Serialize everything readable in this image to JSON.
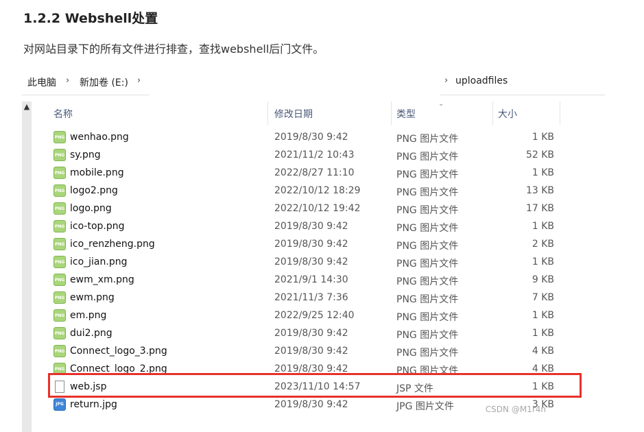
{
  "article": {
    "heading": "1.2.2 Webshell处置",
    "paragraph": "对网站目录下的所有文件进行排查，查找webshell后门文件。"
  },
  "breadcrumb": {
    "items": [
      "此电脑",
      "新加卷 (E:)",
      "uploadfiles"
    ],
    "separator": "›"
  },
  "columns": {
    "name": "名称",
    "date": "修改日期",
    "type": "类型",
    "size": "大小"
  },
  "files": [
    {
      "name": "wenhao.png",
      "date": "2019/8/30 9:42",
      "type": "PNG 图片文件",
      "size": "1 KB",
      "icon": "png-file-icon"
    },
    {
      "name": "sy.png",
      "date": "2021/11/2 10:43",
      "type": "PNG 图片文件",
      "size": "52 KB",
      "icon": "png-file-icon"
    },
    {
      "name": "mobile.png",
      "date": "2022/8/27 11:10",
      "type": "PNG 图片文件",
      "size": "1 KB",
      "icon": "png-file-icon"
    },
    {
      "name": "logo2.png",
      "date": "2022/10/12 18:29",
      "type": "PNG 图片文件",
      "size": "13 KB",
      "icon": "png-file-icon"
    },
    {
      "name": "logo.png",
      "date": "2022/10/12 19:42",
      "type": "PNG 图片文件",
      "size": "17 KB",
      "icon": "png-file-icon"
    },
    {
      "name": "ico-top.png",
      "date": "2019/8/30 9:42",
      "type": "PNG 图片文件",
      "size": "1 KB",
      "icon": "png-file-icon"
    },
    {
      "name": "ico_renzheng.png",
      "date": "2019/8/30 9:42",
      "type": "PNG 图片文件",
      "size": "2 KB",
      "icon": "png-file-icon"
    },
    {
      "name": "ico_jian.png",
      "date": "2019/8/30 9:42",
      "type": "PNG 图片文件",
      "size": "1 KB",
      "icon": "png-file-icon"
    },
    {
      "name": "ewm_xm.png",
      "date": "2021/9/1 14:30",
      "type": "PNG 图片文件",
      "size": "9 KB",
      "icon": "png-file-icon"
    },
    {
      "name": "ewm.png",
      "date": "2021/11/3 7:36",
      "type": "PNG 图片文件",
      "size": "7 KB",
      "icon": "png-file-icon"
    },
    {
      "name": "em.png",
      "date": "2022/9/25 12:40",
      "type": "PNG 图片文件",
      "size": "1 KB",
      "icon": "png-file-icon"
    },
    {
      "name": "dui2.png",
      "date": "2019/8/30 9:42",
      "type": "PNG 图片文件",
      "size": "1 KB",
      "icon": "png-file-icon"
    },
    {
      "name": "Connect_logo_3.png",
      "date": "2019/8/30 9:42",
      "type": "PNG 图片文件",
      "size": "4 KB",
      "icon": "png-file-icon"
    },
    {
      "name": "Connect_logo_2.png",
      "date": "2019/8/30 9:42",
      "type": "PNG 图片文件",
      "size": "4 KB",
      "icon": "png-file-icon"
    },
    {
      "name": "web.jsp",
      "date": "2023/11/10 14:57",
      "type": "JSP 文件",
      "size": "1 KB",
      "icon": "jsp-file-icon",
      "highlighted": true
    },
    {
      "name": "return.jpg",
      "date": "2019/8/30 9:42",
      "type": "JPG 图片文件",
      "size": "3 KB",
      "icon": "jpg-file-icon"
    }
  ],
  "icon_labels": {
    "png": "PNG",
    "jpg": "JPG"
  },
  "colors": {
    "highlight_border": "#e8302a",
    "png_icon": "#a9d67a",
    "jpg_icon": "#3f86d8"
  },
  "watermark": "CSDN @M1r4n"
}
